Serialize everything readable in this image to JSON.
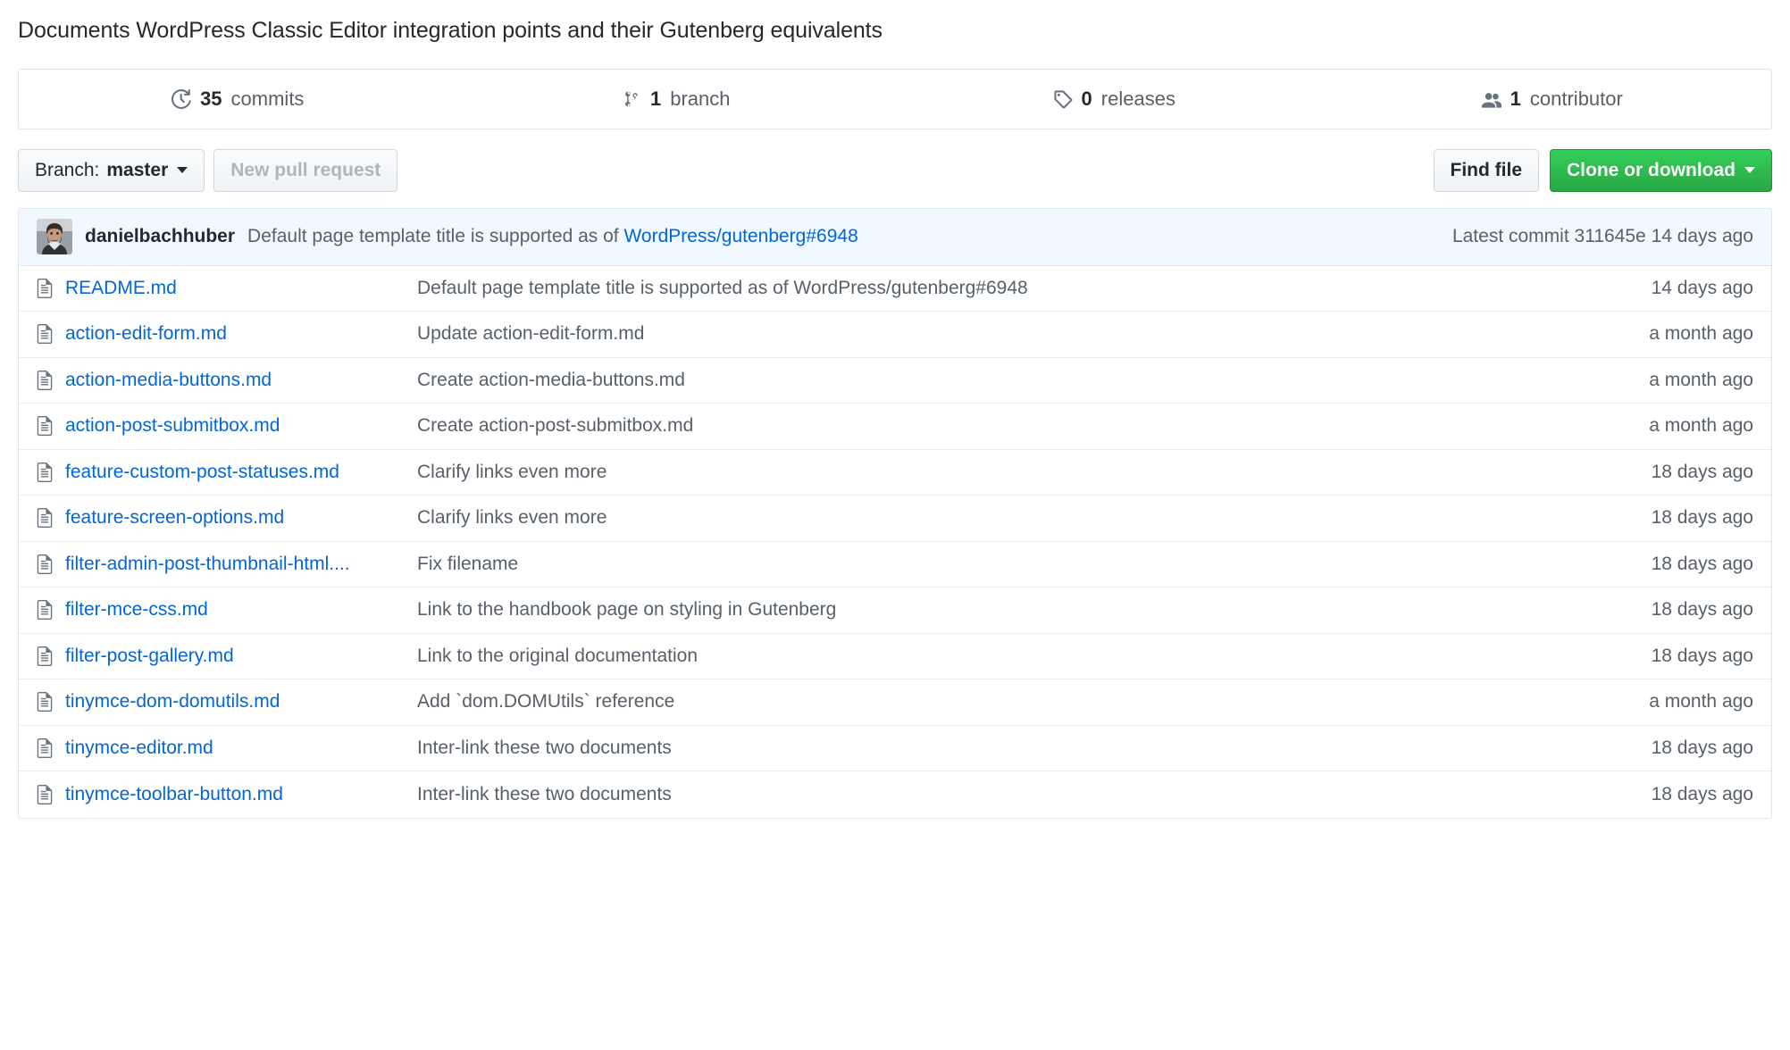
{
  "repo": {
    "description": "Documents WordPress Classic Editor integration points and their Gutenberg equivalents"
  },
  "stats": [
    {
      "icon": "history-icon",
      "count": "35",
      "label": "commits",
      "name": "stat-commits"
    },
    {
      "icon": "git-branch-icon",
      "count": "1",
      "label": "branch",
      "name": "stat-branches"
    },
    {
      "icon": "tag-icon",
      "count": "0",
      "label": "releases",
      "name": "stat-releases"
    },
    {
      "icon": "people-icon",
      "count": "1",
      "label": "contributor",
      "name": "stat-contributors"
    }
  ],
  "toolbar": {
    "branch_prefix": "Branch:",
    "branch_name": "master",
    "new_pull_request_label": "New pull request",
    "find_file_label": "Find file",
    "clone_or_download_label": "Clone or download"
  },
  "latest_commit": {
    "author": "danielbachhuber",
    "message_prefix": "Default page template title is supported as of",
    "message_link": "WordPress/gutenberg#6948",
    "meta_prefix": "Latest commit",
    "sha": "311645e",
    "age": "14 days ago"
  },
  "files": [
    {
      "icon": "file-icon",
      "name": "README.md",
      "message": "Default page template title is supported as of WordPress/gutenberg#6948",
      "age": "14 days ago"
    },
    {
      "icon": "file-icon",
      "name": "action-edit-form.md",
      "message": "Update action-edit-form.md",
      "age": "a month ago"
    },
    {
      "icon": "file-icon",
      "name": "action-media-buttons.md",
      "message": "Create action-media-buttons.md",
      "age": "a month ago"
    },
    {
      "icon": "file-icon",
      "name": "action-post-submitbox.md",
      "message": "Create action-post-submitbox.md",
      "age": "a month ago"
    },
    {
      "icon": "file-icon",
      "name": "feature-custom-post-statuses.md",
      "message": "Clarify links even more",
      "age": "18 days ago"
    },
    {
      "icon": "file-icon",
      "name": "feature-screen-options.md",
      "message": "Clarify links even more",
      "age": "18 days ago"
    },
    {
      "icon": "file-icon",
      "name": "filter-admin-post-thumbnail-html....",
      "message": "Fix filename",
      "age": "18 days ago"
    },
    {
      "icon": "file-icon",
      "name": "filter-mce-css.md",
      "message": "Link to the handbook page on styling in Gutenberg",
      "age": "18 days ago"
    },
    {
      "icon": "file-icon",
      "name": "filter-post-gallery.md",
      "message": "Link to the original documentation",
      "age": "18 days ago"
    },
    {
      "icon": "file-icon",
      "name": "tinymce-dom-domutils.md",
      "message": "Add `dom.DOMUtils` reference",
      "age": "a month ago"
    },
    {
      "icon": "file-icon",
      "name": "tinymce-editor.md",
      "message": "Inter-link these two documents",
      "age": "18 days ago"
    },
    {
      "icon": "file-icon",
      "name": "tinymce-toolbar-button.md",
      "message": "Inter-link these two documents",
      "age": "18 days ago"
    }
  ],
  "colors": {
    "link": "#0366d6",
    "text": "#24292e",
    "muted": "#586069",
    "border": "#e1e4e8",
    "commit_bar_bg": "#f1f8ff",
    "green_button": "#28a745"
  }
}
